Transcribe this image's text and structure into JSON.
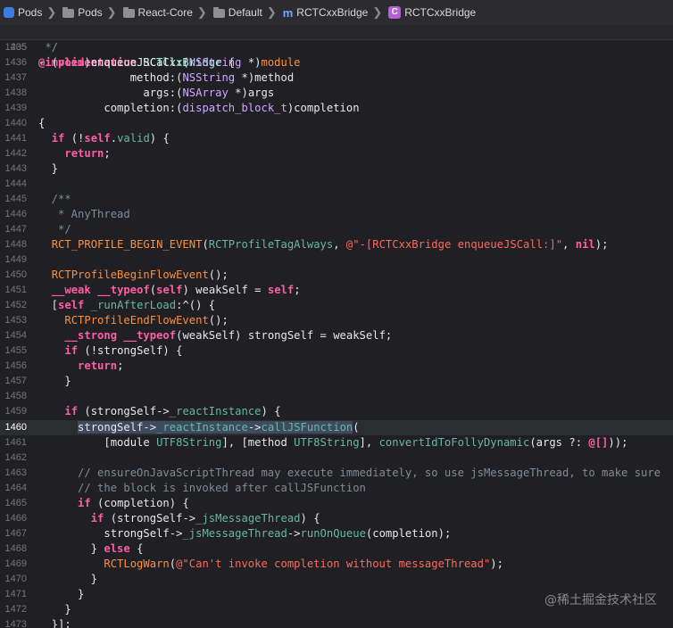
{
  "breadcrumb": [
    {
      "label": "Pods",
      "icon": "app-icon"
    },
    {
      "label": "Pods",
      "icon": "folder-icon"
    },
    {
      "label": "React-Core",
      "icon": "folder-icon"
    },
    {
      "label": "Default",
      "icon": "folder-icon"
    },
    {
      "label": "RCTCxxBridge",
      "icon": "m-file-icon",
      "glyph": "m"
    },
    {
      "label": "RCTCxxBridge",
      "icon": "class-icon",
      "glyph": "C"
    }
  ],
  "sticky": {
    "num": "205",
    "tokens": [
      [
        "kw",
        "@implementation"
      ],
      [
        "pl",
        " "
      ],
      [
        "cl",
        "RCTCxxBridge"
      ],
      [
        "pl",
        " {"
      ]
    ]
  },
  "current_line": "1460",
  "lines": [
    {
      "num": "1435",
      "tokens": [
        [
          "cm",
          " */"
        ]
      ]
    },
    {
      "num": "1436",
      "tokens": [
        [
          "pl",
          "- ("
        ],
        [
          "kw",
          "void"
        ],
        [
          "pl",
          ")enqueueJSCall:("
        ],
        [
          "ty",
          "NSString"
        ],
        [
          "pl",
          " *)"
        ],
        [
          "mc",
          "module"
        ]
      ]
    },
    {
      "num": "1437",
      "tokens": [
        [
          "pl",
          "              method:("
        ],
        [
          "ty",
          "NSString"
        ],
        [
          "pl",
          " *)method"
        ]
      ]
    },
    {
      "num": "1438",
      "tokens": [
        [
          "pl",
          "                args:("
        ],
        [
          "ty",
          "NSArray"
        ],
        [
          "pl",
          " *)args"
        ]
      ]
    },
    {
      "num": "1439",
      "tokens": [
        [
          "pl",
          "          completion:("
        ],
        [
          "ty",
          "dispatch_block_t"
        ],
        [
          "pl",
          ")completion"
        ]
      ]
    },
    {
      "num": "1440",
      "tokens": [
        [
          "pl",
          "{"
        ]
      ]
    },
    {
      "num": "1441",
      "tokens": [
        [
          "pl",
          "  "
        ],
        [
          "kw",
          "if"
        ],
        [
          "pl",
          " (!"
        ],
        [
          "kw",
          "self"
        ],
        [
          "pl",
          "."
        ],
        [
          "fn",
          "valid"
        ],
        [
          "pl",
          ") {"
        ]
      ]
    },
    {
      "num": "1442",
      "tokens": [
        [
          "pl",
          "    "
        ],
        [
          "kw",
          "return"
        ],
        [
          "pl",
          ";"
        ]
      ]
    },
    {
      "num": "1443",
      "tokens": [
        [
          "pl",
          "  }"
        ]
      ]
    },
    {
      "num": "1444",
      "tokens": []
    },
    {
      "num": "1445",
      "tokens": [
        [
          "cm",
          "  /**"
        ]
      ]
    },
    {
      "num": "1446",
      "tokens": [
        [
          "cm",
          "   * AnyThread"
        ]
      ]
    },
    {
      "num": "1447",
      "tokens": [
        [
          "cm",
          "   */"
        ]
      ]
    },
    {
      "num": "1448",
      "tokens": [
        [
          "pl",
          "  "
        ],
        [
          "mc",
          "RCT_PROFILE_BEGIN_EVENT"
        ],
        [
          "pl",
          "("
        ],
        [
          "fn",
          "RCTProfileTagAlways"
        ],
        [
          "pl",
          ", "
        ],
        [
          "st",
          "@\"-[RCTCxxBridge enqueueJSCall:]\""
        ],
        [
          "pl",
          ", "
        ],
        [
          "kw",
          "nil"
        ],
        [
          "pl",
          ");"
        ]
      ]
    },
    {
      "num": "1449",
      "tokens": []
    },
    {
      "num": "1450",
      "tokens": [
        [
          "pl",
          "  "
        ],
        [
          "mc",
          "RCTProfileBeginFlowEvent"
        ],
        [
          "pl",
          "();"
        ]
      ]
    },
    {
      "num": "1451",
      "tokens": [
        [
          "pl",
          "  "
        ],
        [
          "kw",
          "__weak"
        ],
        [
          "pl",
          " "
        ],
        [
          "kw",
          "__typeof"
        ],
        [
          "pl",
          "("
        ],
        [
          "kw",
          "self"
        ],
        [
          "pl",
          ") weakSelf = "
        ],
        [
          "kw",
          "self"
        ],
        [
          "pl",
          ";"
        ]
      ]
    },
    {
      "num": "1452",
      "tokens": [
        [
          "pl",
          "  ["
        ],
        [
          "kw",
          "self"
        ],
        [
          "pl",
          " "
        ],
        [
          "fn",
          "_runAfterLoad"
        ],
        [
          "pl",
          ":^() {"
        ]
      ]
    },
    {
      "num": "1453",
      "tokens": [
        [
          "pl",
          "    "
        ],
        [
          "mc",
          "RCTProfileEndFlowEvent"
        ],
        [
          "pl",
          "();"
        ]
      ]
    },
    {
      "num": "1454",
      "tokens": [
        [
          "pl",
          "    "
        ],
        [
          "kw",
          "__strong"
        ],
        [
          "pl",
          " "
        ],
        [
          "kw",
          "__typeof"
        ],
        [
          "pl",
          "(weakSelf) strongSelf = weakSelf;"
        ]
      ]
    },
    {
      "num": "1455",
      "tokens": [
        [
          "pl",
          "    "
        ],
        [
          "kw",
          "if"
        ],
        [
          "pl",
          " (!strongSelf) {"
        ]
      ]
    },
    {
      "num": "1456",
      "tokens": [
        [
          "pl",
          "      "
        ],
        [
          "kw",
          "return"
        ],
        [
          "pl",
          ";"
        ]
      ]
    },
    {
      "num": "1457",
      "tokens": [
        [
          "pl",
          "    }"
        ]
      ]
    },
    {
      "num": "1458",
      "tokens": []
    },
    {
      "num": "1459",
      "tokens": [
        [
          "pl",
          "    "
        ],
        [
          "kw",
          "if"
        ],
        [
          "pl",
          " (strongSelf->"
        ],
        [
          "fn",
          "_reactInstance"
        ],
        [
          "pl",
          ") {"
        ]
      ]
    },
    {
      "num": "1460",
      "tokens": [
        [
          "pl",
          "      "
        ],
        [
          "hl",
          "strongSelf->"
        ],
        [
          "fn hl",
          "_reactInstance"
        ],
        [
          "hl",
          "->"
        ],
        [
          "fn hl",
          "callJSFunction"
        ],
        [
          "pl",
          "("
        ]
      ]
    },
    {
      "num": "1461",
      "tokens": [
        [
          "pl",
          "          [module "
        ],
        [
          "fn",
          "UTF8String"
        ],
        [
          "pl",
          "], [method "
        ],
        [
          "fn",
          "UTF8String"
        ],
        [
          "pl",
          "], "
        ],
        [
          "fn",
          "convertIdToFollyDynamic"
        ],
        [
          "pl",
          "(args ?: "
        ],
        [
          "kw",
          "@[]"
        ],
        [
          "pl",
          "));"
        ]
      ]
    },
    {
      "num": "1462",
      "tokens": []
    },
    {
      "num": "1463",
      "tokens": [
        [
          "cm",
          "      // ensureOnJavaScriptThread may execute immediately, so use jsMessageThread, to make sure"
        ]
      ]
    },
    {
      "num": "1464",
      "tokens": [
        [
          "cm",
          "      // the block is invoked after callJSFunction"
        ]
      ]
    },
    {
      "num": "1465",
      "tokens": [
        [
          "pl",
          "      "
        ],
        [
          "kw",
          "if"
        ],
        [
          "pl",
          " (completion) {"
        ]
      ]
    },
    {
      "num": "1466",
      "tokens": [
        [
          "pl",
          "        "
        ],
        [
          "kw",
          "if"
        ],
        [
          "pl",
          " (strongSelf->"
        ],
        [
          "fn",
          "_jsMessageThread"
        ],
        [
          "pl",
          ") {"
        ]
      ]
    },
    {
      "num": "1467",
      "tokens": [
        [
          "pl",
          "          strongSelf->"
        ],
        [
          "fn",
          "_jsMessageThread"
        ],
        [
          "pl",
          "->"
        ],
        [
          "fn",
          "runOnQueue"
        ],
        [
          "pl",
          "(completion);"
        ]
      ]
    },
    {
      "num": "1468",
      "tokens": [
        [
          "pl",
          "        } "
        ],
        [
          "kw",
          "else"
        ],
        [
          "pl",
          " {"
        ]
      ]
    },
    {
      "num": "1469",
      "tokens": [
        [
          "pl",
          "          "
        ],
        [
          "mc",
          "RCTLogWarn"
        ],
        [
          "pl",
          "("
        ],
        [
          "st",
          "@\"Can't invoke completion without messageThread\""
        ],
        [
          "pl",
          ");"
        ]
      ]
    },
    {
      "num": "1470",
      "tokens": [
        [
          "pl",
          "        }"
        ]
      ]
    },
    {
      "num": "1471",
      "tokens": [
        [
          "pl",
          "      }"
        ]
      ]
    },
    {
      "num": "1472",
      "tokens": [
        [
          "pl",
          "    }"
        ]
      ]
    },
    {
      "num": "1473",
      "tokens": [
        [
          "pl",
          "  }];"
        ]
      ]
    }
  ],
  "watermark": "@稀土掘金技术社区"
}
